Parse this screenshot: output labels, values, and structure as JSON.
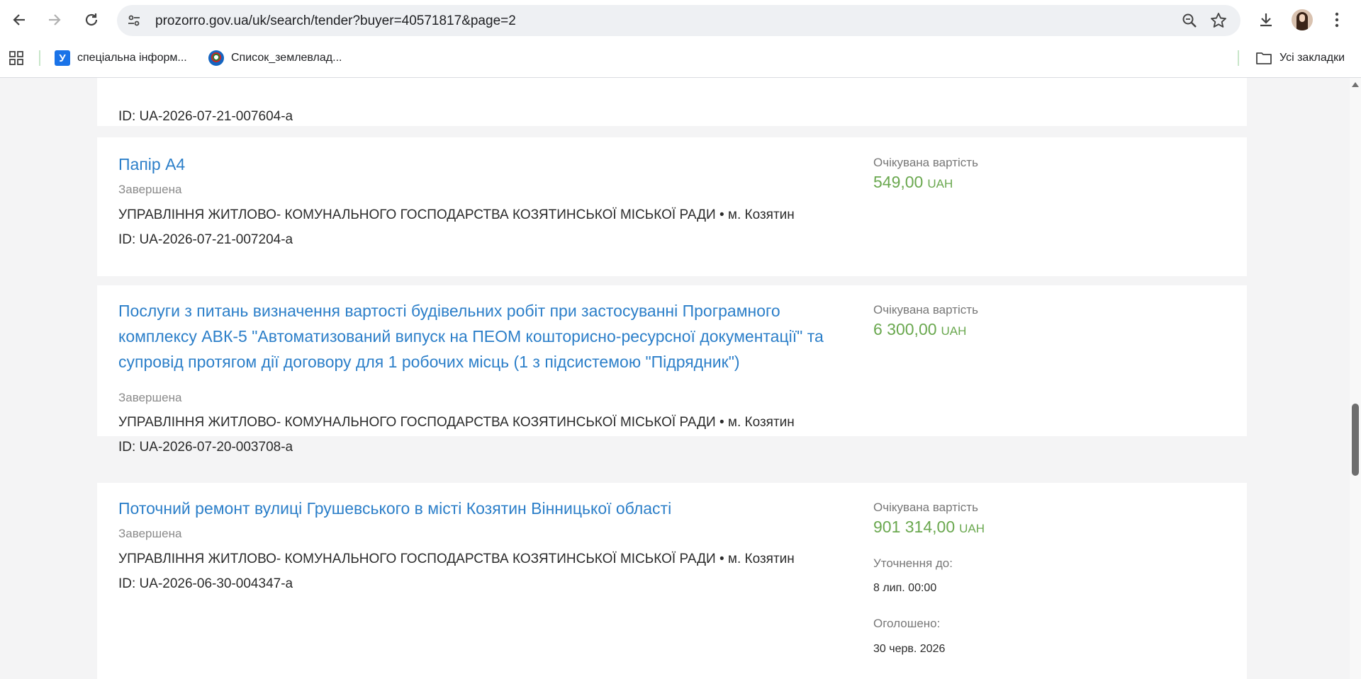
{
  "browser": {
    "url": "prozorro.gov.ua/uk/search/tender?buyer=40571817&page=2",
    "bookmarks": [
      {
        "label": "спеціальна інформ...",
        "icon": "u-favicon"
      },
      {
        "label": "Список_землевлад...",
        "icon": "wikimedia-favicon"
      }
    ],
    "all_bookmarks_label": "Усі закладки"
  },
  "tenders": [
    {
      "id_text": "ID: UA-2026-07-21-007604-a"
    },
    {
      "title": "Папір А4",
      "status": "Завершена",
      "org": "УПРАВЛІННЯ ЖИТЛОВО- КОМУНАЛЬНОГО ГОСПОДАРСТВА КОЗЯТИНСЬКОЇ МІСЬКОЇ РАДИ • м. Козятин",
      "id_text": "ID: UA-2026-07-21-007204-a",
      "cost_label": "Очікувана вартість",
      "cost_value": "549,00",
      "currency": "UAH"
    },
    {
      "title": "Послуги з питань визначення вартості будівельних робіт при застосуванні Програмного комплексу АВК-5 \"Автоматизований випуск на ПЕОМ кошторисно-ресурсної документації\" та супровід протягом дії договору для 1 робочих місць (1 з підсистемою \"Підрядник\")",
      "status": "Завершена",
      "org": "УПРАВЛІННЯ ЖИТЛОВО- КОМУНАЛЬНОГО ГОСПОДАРСТВА КОЗЯТИНСЬКОЇ МІСЬКОЇ РАДИ • м. Козятин",
      "id_text": "ID: UA-2026-07-20-003708-a",
      "cost_label": "Очікувана вартість",
      "cost_value": "6 300,00",
      "currency": "UAH"
    },
    {
      "title": "Поточний ремонт вулиці Грушевського в місті Козятин Вінницької області",
      "status": "Завершена",
      "org": "УПРАВЛІННЯ ЖИТЛОВО- КОМУНАЛЬНОГО ГОСПОДАРСТВА КОЗЯТИНСЬКОЇ МІСЬКОЇ РАДИ • м. Козятин",
      "id_text": "ID: UA-2026-06-30-004347-a",
      "cost_label": "Очікувана вартість",
      "cost_value": "901 314,00",
      "currency": "UAH",
      "clarification_label": "Уточнення до:",
      "clarification_value": "8 лип. 00:00",
      "announced_label": "Оголошено:",
      "announced_value": "30 черв. 2026"
    }
  ],
  "colors": {
    "link": "#2c7fc9",
    "price": "#6aa84f",
    "page_bg": "#f4f4f5"
  }
}
